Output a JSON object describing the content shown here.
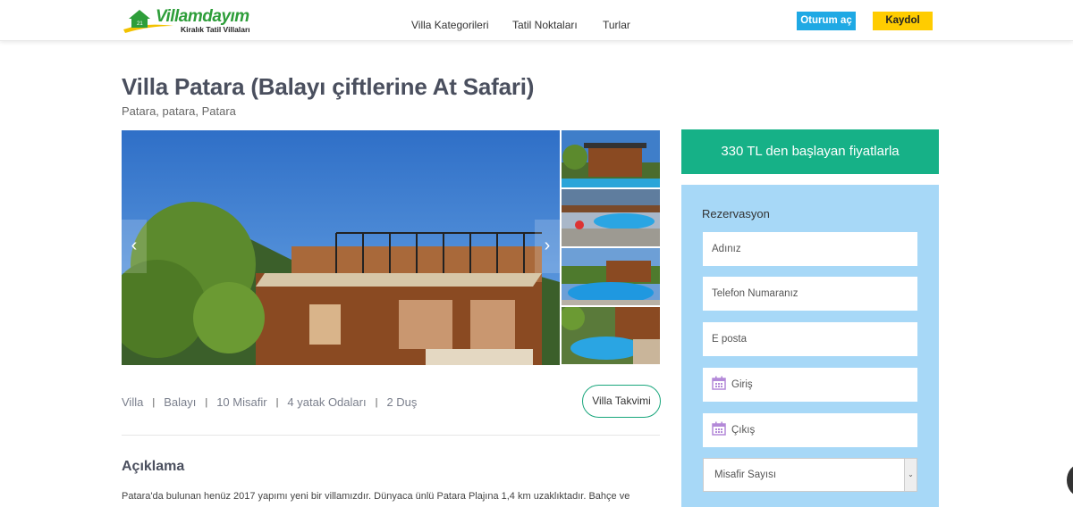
{
  "header": {
    "logo_name": "Villamdayım",
    "logo_tagline": "Kiralık Tatil Villaları",
    "nav": [
      "Villa Kategorileri",
      "Tatil Noktaları",
      "Turlar"
    ],
    "login_label": "Oturum aç",
    "signup_label": "Kaydol"
  },
  "villa": {
    "title": "Villa Patara (Balayı çiftlerine At Safari)",
    "location": "Patara, patara, Patara",
    "features": [
      "Villa",
      "Balayı",
      "10 Misafir",
      "4 yatak Odaları",
      "2 Duş"
    ],
    "calendar_button": "Villa Takvimi",
    "description_title": "Açıklama",
    "description_text": "Patara'da bulunan henüz 2017 yapımı yeni bir villamızdır. Dünyaca ünlü Patara Plajına 1,4 km uzaklıktadır. Bahçe ve"
  },
  "gallery": {
    "prev_icon": "‹",
    "next_icon": "›"
  },
  "sidebar": {
    "price_banner": "330 TL den başlayan fiyatlarla",
    "reservation_title": "Rezervasyon",
    "name_placeholder": "Adınız",
    "phone_placeholder": "Telefon Numaranız",
    "email_placeholder": "E posta",
    "checkin_placeholder": "Giriş",
    "checkout_placeholder": "Çıkış",
    "guests_select": "Misafir Sayısı"
  },
  "colors": {
    "green": "#16b187",
    "blue_button": "#1fa9e4",
    "yellow_button": "#ffcc00",
    "reservation_bg": "#a7d8f7"
  }
}
